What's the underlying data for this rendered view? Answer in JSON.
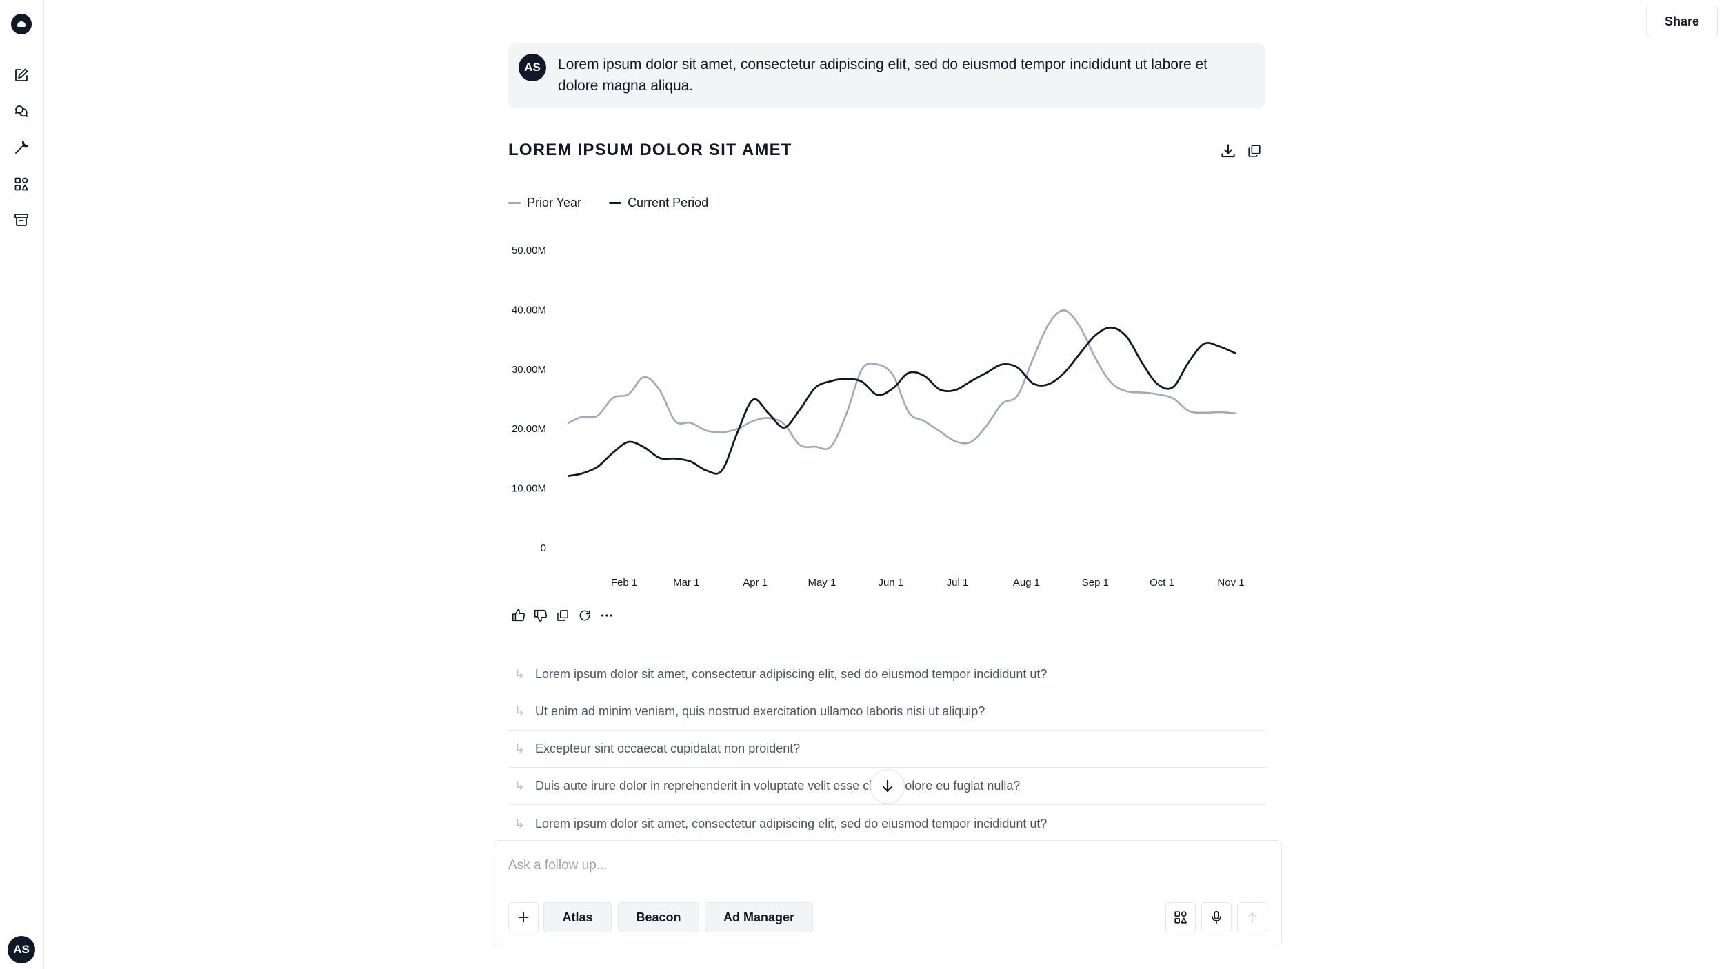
{
  "sidebar": {
    "logo": "app-logo",
    "items": [
      {
        "name": "new-chat",
        "icon": "edit-icon"
      },
      {
        "name": "chats",
        "icon": "chat-bubbles-icon"
      },
      {
        "name": "tools",
        "icon": "wrench-icon"
      },
      {
        "name": "apps",
        "icon": "apps-grid-icon"
      },
      {
        "name": "archive",
        "icon": "archive-box-icon"
      }
    ],
    "user_initials": "AS"
  },
  "header": {
    "share_label": "Share"
  },
  "user_message": {
    "initials": "AS",
    "text": "Lorem ipsum dolor sit amet, consectetur adipiscing elit, sed do eiusmod tempor incididunt ut labore et dolore magna aliqua."
  },
  "chart_card": {
    "title": "LOREM IPSUM DOLOR SIT AMET",
    "actions": [
      "download-icon",
      "copy-icon"
    ]
  },
  "chart_data": {
    "type": "line",
    "title": "LOREM IPSUM DOLOR SIT AMET",
    "xlabel": "",
    "ylabel": "",
    "ylim": [
      0,
      50000000
    ],
    "y_ticks": [
      "0",
      "10.00M",
      "20.00M",
      "30.00M",
      "40.00M",
      "50.00M"
    ],
    "x_ticks": [
      "Feb 1",
      "Mar 1",
      "Apr 1",
      "May 1",
      "Jun 1",
      "Jul 1",
      "Aug 1",
      "Sep 1",
      "Oct 1",
      "Nov 1"
    ],
    "legend_position": "top-left",
    "grid": false,
    "series": [
      {
        "name": "Prior Year",
        "color": "#9aabbf",
        "x": [
          "Jan 7",
          "Jan 13",
          "Jan 20",
          "Jan 27",
          "Feb 3",
          "Feb 10",
          "Feb 17",
          "Feb 24",
          "Mar 3",
          "Mar 10",
          "Mar 17",
          "Mar 24",
          "Mar 31",
          "Apr 7",
          "Apr 14",
          "Apr 21",
          "Apr 28",
          "May 5",
          "May 12",
          "May 19",
          "May 26",
          "Jun 2",
          "Jun 9",
          "Jun 16",
          "Jun 23",
          "Jun 30",
          "Jul 7",
          "Jul 14",
          "Jul 21",
          "Jul 28",
          "Aug 4",
          "Aug 11",
          "Aug 18",
          "Aug 25",
          "Sep 1",
          "Sep 8",
          "Sep 15",
          "Sep 22",
          "Sep 29",
          "Oct 6",
          "Oct 13",
          "Oct 20",
          "Oct 27",
          "Nov 3"
        ],
        "values": [
          21000000,
          22000000,
          22200000,
          25200000,
          25800000,
          28700000,
          26500000,
          21300000,
          21000000,
          19700000,
          19400000,
          20000000,
          21300000,
          21800000,
          20800000,
          17300000,
          17000000,
          17000000,
          22500000,
          30000000,
          30800000,
          29000000,
          22800000,
          21300000,
          19600000,
          17900000,
          17800000,
          20500000,
          24200000,
          25600000,
          31800000,
          37600000,
          39900000,
          37200000,
          31900000,
          27800000,
          26300000,
          26100000,
          25800000,
          25100000,
          23000000,
          22700000,
          22800000,
          22600000
        ]
      },
      {
        "name": "Current Period",
        "color": "#111827",
        "x": [
          "Jan 7",
          "Jan 13",
          "Jan 20",
          "Jan 27",
          "Feb 3",
          "Feb 10",
          "Feb 17",
          "Feb 24",
          "Mar 3",
          "Mar 10",
          "Mar 17",
          "Mar 24",
          "Mar 31",
          "Apr 7",
          "Apr 14",
          "Apr 21",
          "Apr 28",
          "May 5",
          "May 12",
          "May 19",
          "May 26",
          "Jun 2",
          "Jun 9",
          "Jun 16",
          "Jun 23",
          "Jun 30",
          "Jul 7",
          "Jul 14",
          "Jul 21",
          "Jul 28",
          "Aug 4",
          "Aug 11",
          "Aug 18",
          "Aug 25",
          "Sep 1",
          "Sep 8",
          "Sep 15",
          "Sep 22",
          "Sep 29",
          "Oct 6",
          "Oct 13",
          "Oct 20",
          "Oct 27",
          "Nov 3"
        ],
        "values": [
          12100000,
          12500000,
          13600000,
          16000000,
          17800000,
          16900000,
          15100000,
          15000000,
          14500000,
          13000000,
          13000000,
          19400000,
          24900000,
          22600000,
          20200000,
          23200000,
          26900000,
          28000000,
          28400000,
          27900000,
          25700000,
          26800000,
          29400000,
          28900000,
          26600000,
          26500000,
          28000000,
          29400000,
          30800000,
          30300000,
          27600000,
          27500000,
          29400000,
          32600000,
          35700000,
          37000000,
          35500000,
          31100000,
          27500000,
          27000000,
          31200000,
          34300000,
          33800000,
          32700000
        ]
      }
    ]
  },
  "message_actions": [
    "thumbs-up-icon",
    "thumbs-down-icon",
    "copy-icon",
    "refresh-icon",
    "more-icon"
  ],
  "suggestions": [
    "Lorem ipsum dolor sit amet, consectetur adipiscing elit, sed do eiusmod tempor incididunt ut?",
    "Ut enim ad minim veniam, quis nostrud exercitation ullamco laboris nisi ut aliquip?",
    "Excepteur sint occaecat cupidatat non proident?",
    "Duis aute irure dolor in reprehenderit in voluptate velit esse cillum dolore eu fugiat nulla?",
    "Lorem ipsum dolor sit amet, consectetur adipiscing elit, sed do eiusmod tempor incididunt ut?"
  ],
  "composer": {
    "placeholder": "Ask a follow up...",
    "value": "",
    "chips": [
      "Atlas",
      "Beacon",
      "Ad Manager"
    ]
  }
}
